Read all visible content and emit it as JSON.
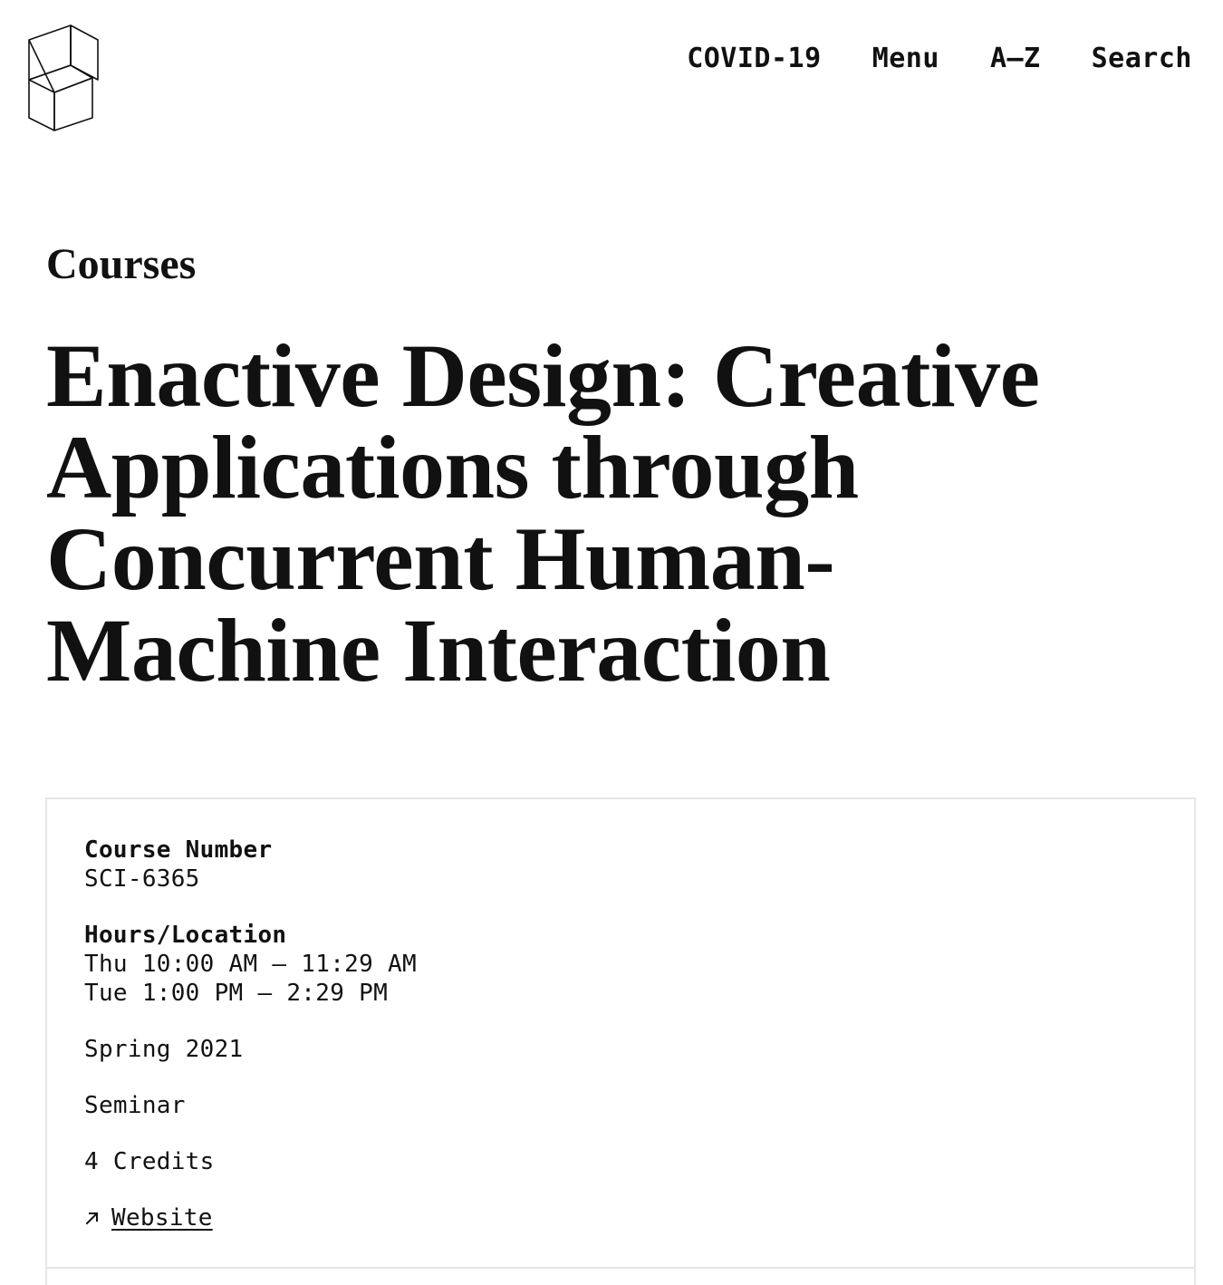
{
  "header": {
    "logo_icon": "geometric-facet-logo-icon",
    "nav": [
      {
        "label": "COVID-19"
      },
      {
        "label": "Menu"
      },
      {
        "label": "A–Z"
      },
      {
        "label": "Search"
      }
    ]
  },
  "breadcrumb": {
    "label": "Courses"
  },
  "page": {
    "title": "Enactive Design: Creative Applications through Concurrent Human-Machine Interaction"
  },
  "course": {
    "number_label": "Course Number",
    "number_value": "SCI-6365",
    "hours_label": "Hours/Location",
    "hours": [
      "Thu 10:00 AM – 11:29 AM",
      "Tue 1:00 PM – 2:29 PM"
    ],
    "term": "Spring 2021",
    "format": "Seminar",
    "credits": "4 Credits",
    "website_icon": "external-link-arrow-icon",
    "website_label": "Website"
  }
}
